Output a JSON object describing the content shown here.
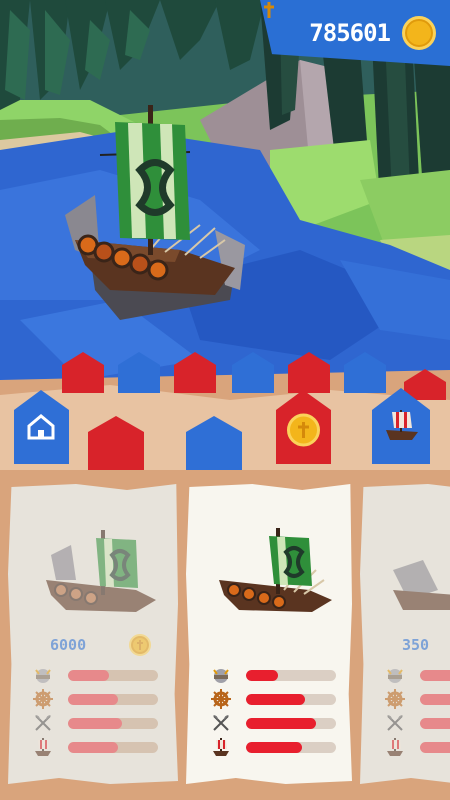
{
  "header": {
    "coins": "785601",
    "coin_icon": "gold-coin-icon"
  },
  "menu": {
    "home_icon": "home-icon",
    "coin_icon": "coin-icon",
    "ships_icon": "viking-ship-icon"
  },
  "cards": [
    {
      "price": "6000",
      "locked": true,
      "sail_color": "#2f8f3a",
      "stats": [
        {
          "name": "helmet",
          "level": 0.45
        },
        {
          "name": "wheel",
          "level": 0.55
        },
        {
          "name": "axes",
          "level": 0.6
        },
        {
          "name": "ship",
          "level": 0.55
        }
      ]
    },
    {
      "price": "",
      "locked": false,
      "selected": true,
      "sail_color": "#2f8f3a",
      "stats": [
        {
          "name": "helmet",
          "level": 0.35
        },
        {
          "name": "wheel",
          "level": 0.65
        },
        {
          "name": "axes",
          "level": 0.78
        },
        {
          "name": "ship",
          "level": 0.62
        }
      ]
    },
    {
      "price": "350",
      "locked": true,
      "stats": [
        {
          "name": "helmet",
          "level": 0.5
        },
        {
          "name": "wheel",
          "level": 0.5
        },
        {
          "name": "axes",
          "level": 0.5
        },
        {
          "name": "ship",
          "level": 0.5
        }
      ]
    }
  ]
}
